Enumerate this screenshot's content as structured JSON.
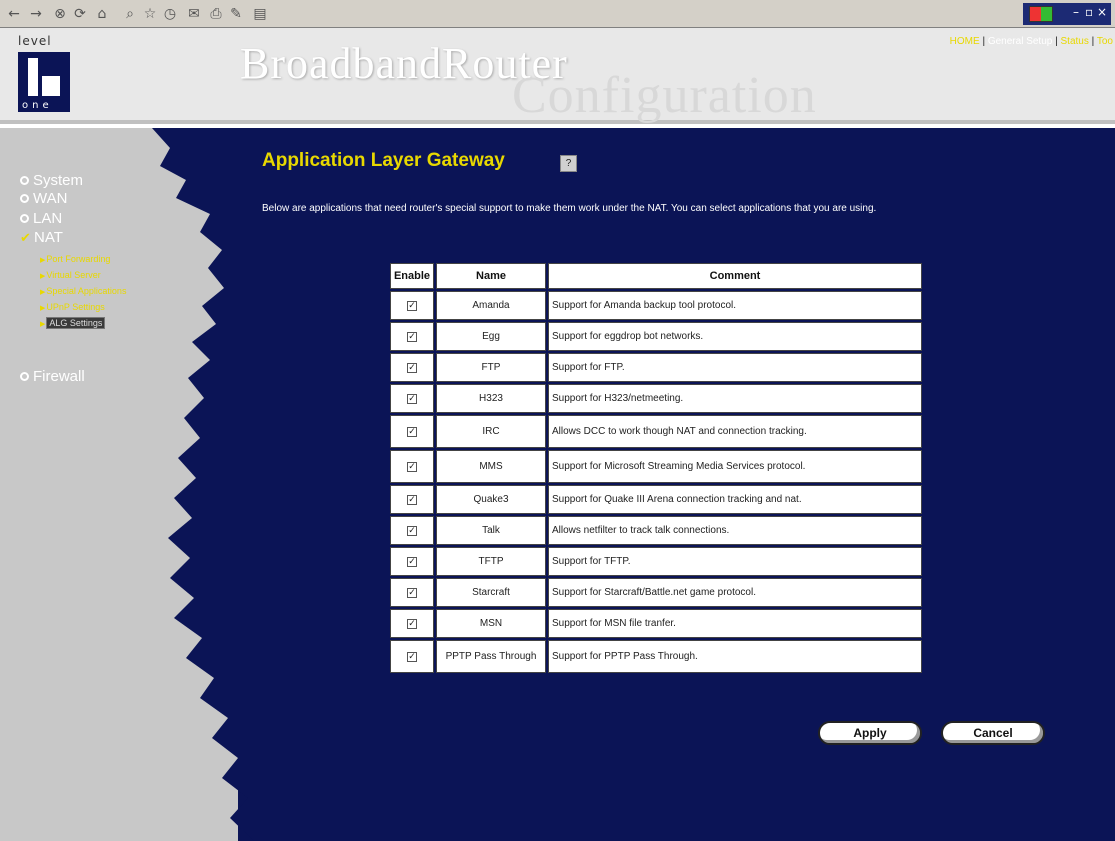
{
  "header": {
    "logo_top": "level",
    "logo_bottom": "one",
    "title_main": "BroadbandRouter",
    "title_sub": "Configuration",
    "topnav": {
      "home": "HOME",
      "general_setup": "General Setup",
      "status": "Status",
      "tools": "Too"
    }
  },
  "sidebar": {
    "items": [
      {
        "label": "System"
      },
      {
        "label": "WAN"
      },
      {
        "label": "LAN"
      },
      {
        "label": "NAT"
      },
      {
        "label": "Firewall"
      }
    ],
    "nat_sub": [
      {
        "label": "Port Forwarding"
      },
      {
        "label": "Virtual Server"
      },
      {
        "label": "Special Applications"
      },
      {
        "label": "UPnP Settings"
      },
      {
        "label": "ALG Settings"
      }
    ]
  },
  "main": {
    "title": "Application Layer Gateway",
    "help": "?",
    "description": "Below are applications that need router's special support to make them work under the NAT. You can select applications that you are using.",
    "table": {
      "headers": {
        "enable": "Enable",
        "name": "Name",
        "comment": "Comment"
      },
      "rows": [
        {
          "checked": true,
          "name": "Amanda",
          "comment": "Support for Amanda backup tool protocol."
        },
        {
          "checked": true,
          "name": "Egg",
          "comment": "Support for eggdrop bot networks."
        },
        {
          "checked": true,
          "name": "FTP",
          "comment": "Support for FTP."
        },
        {
          "checked": true,
          "name": "H323",
          "comment": "Support for H323/netmeeting."
        },
        {
          "checked": true,
          "name": "IRC",
          "comment": "Allows DCC to work though NAT and connection tracking."
        },
        {
          "checked": true,
          "name": "MMS",
          "comment": "Support for Microsoft Streaming Media Services protocol."
        },
        {
          "checked": true,
          "name": "Quake3",
          "comment": "Support for Quake III Arena connection tracking and nat."
        },
        {
          "checked": true,
          "name": "Talk",
          "comment": "Allows netfilter to track talk connections."
        },
        {
          "checked": true,
          "name": "TFTP",
          "comment": "Support for TFTP."
        },
        {
          "checked": true,
          "name": "Starcraft",
          "comment": "Support for Starcraft/Battle.net game protocol."
        },
        {
          "checked": true,
          "name": "MSN",
          "comment": "Support for MSN file tranfer."
        },
        {
          "checked": true,
          "name": "PPTP Pass Through",
          "comment": "Support for PPTP Pass Through."
        }
      ]
    },
    "buttons": {
      "apply": "Apply",
      "cancel": "Cancel"
    }
  }
}
